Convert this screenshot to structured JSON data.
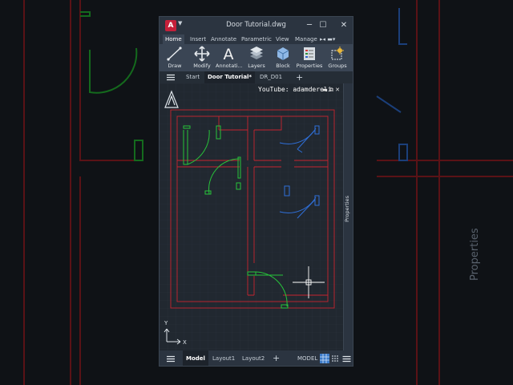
{
  "window": {
    "title": "Door Tutorial.dwg",
    "logo": "A",
    "controls": {
      "minimize": "─",
      "maximize": "☐",
      "close": "✕"
    }
  },
  "ribbon": {
    "tabs": [
      "Home",
      "Insert",
      "Annotate",
      "Parametric",
      "View",
      "Manage"
    ],
    "overflow": "▸◂ ▬▾",
    "buttons": [
      "Draw",
      "Modify",
      "Annotati...",
      "Layers",
      "Block",
      "Properties",
      "Groups"
    ]
  },
  "doc_tabs": {
    "menu_icon": "hamburger-icon",
    "items": [
      "Start",
      "Door Tutorial*",
      "DR_D01"
    ],
    "add": "+"
  },
  "canvas": {
    "credit": "YouTube: adamdereli",
    "viewport_controls": "▬ ⧉ ✕",
    "ucs_x": "X",
    "ucs_y": "Y"
  },
  "properties_panel": {
    "label": "Properties"
  },
  "background": {
    "side_label": "Properties"
  },
  "status": {
    "tabs": [
      "Model",
      "Layout1",
      "Layout2"
    ],
    "add": "+",
    "mode": "MODEL"
  },
  "colors": {
    "wall": "#d22630",
    "door_left": "#27c33a",
    "door_right": "#2f6fd8",
    "cursor": "#ffffff",
    "canvas_bg": "#212830",
    "ribbon_bg": "#3a4554"
  }
}
